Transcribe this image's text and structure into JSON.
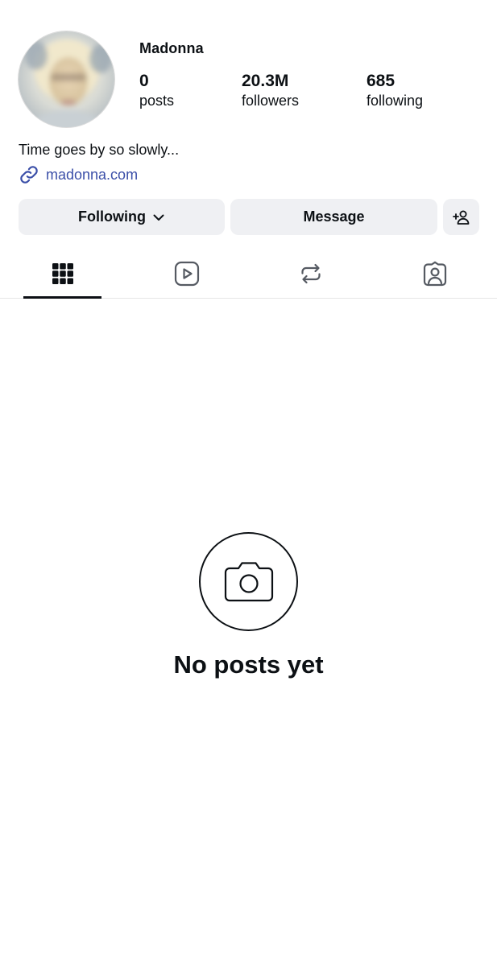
{
  "profile": {
    "username": "Madonna",
    "avatar_alt": "profile photo",
    "stats": {
      "posts_count": "0",
      "posts_label": "posts",
      "followers_count": "20.3M",
      "followers_label": "followers",
      "following_count": "685",
      "following_label": "following"
    },
    "bio": "Time goes by so slowly...",
    "link": "madonna.com"
  },
  "actions": {
    "following_label": "Following",
    "message_label": "Message",
    "add_user_icon": "add-person-icon"
  },
  "tabs": [
    {
      "icon": "grid-icon",
      "active": true
    },
    {
      "icon": "reels-icon",
      "active": false
    },
    {
      "icon": "reposts-icon",
      "active": false
    },
    {
      "icon": "tagged-icon",
      "active": false
    }
  ],
  "empty_state": {
    "icon": "camera-icon",
    "title": "No posts yet"
  },
  "colors": {
    "text": "#0c1014",
    "link": "#3b4fa8",
    "button_bg": "#eff0f3",
    "divider": "#e6e6e6",
    "icon_gray": "#555a62"
  }
}
